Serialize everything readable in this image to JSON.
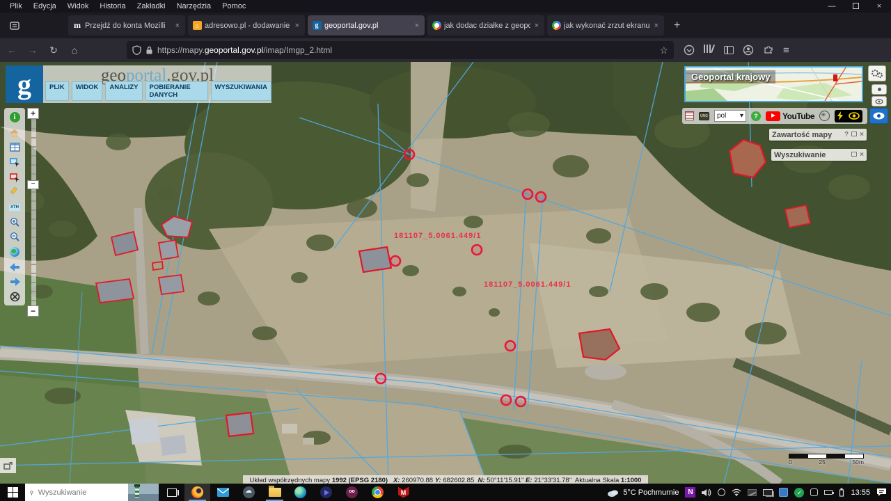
{
  "browser": {
    "menus": [
      "Plik",
      "Edycja",
      "Widok",
      "Historia",
      "Zakładki",
      "Narzędzia",
      "Pomoc"
    ],
    "controls": {
      "minimize": "—",
      "close": "×"
    },
    "tabs": [
      {
        "title": "Przejdź do konta Mozilli"
      },
      {
        "title": "adresowo.pl - dodawanie bezpł"
      },
      {
        "title": "geoportal.gov.pl"
      },
      {
        "title": "jak dodac działke z geoportalu"
      },
      {
        "title": "jak wykonać zrzut ekranu w lapt"
      }
    ],
    "close_glyph": "×",
    "new_tab_glyph": "+",
    "nav": {
      "back": "←",
      "forward": "→",
      "reload": "↻",
      "home": "⌂",
      "bookmark": "☆",
      "menu": "≡"
    },
    "url": {
      "prefix": "https://mapy.",
      "host": "geoportal.gov.pl",
      "path": "/imap/Imgp_2.html"
    }
  },
  "geoportal": {
    "brand": {
      "geo": "geo",
      "portal": "portal",
      "tld": ".gov.pl"
    },
    "menu": [
      "PLIK",
      "WIDOK",
      "ANALIZY",
      "POBIERANIE DANYCH",
      "WYSZUKIWANIA"
    ],
    "logo_glyph": "g",
    "overview_title": "Geoportal krajowy",
    "language_selected": "pol",
    "language_caret": "▾",
    "youtube_label": "YouTube",
    "help_glyph": "?",
    "info_glyph": "i",
    "xth_label": "XTH",
    "panels": {
      "map_contents": "Zawartość mapy",
      "search": "Wyszukiwanie",
      "help_glyph": "?",
      "close_glyph": "×"
    },
    "parcel_label": "181107_5.0061.449/1",
    "scalebar": {
      "zero": "0",
      "mid": "25",
      "max": "50m"
    },
    "statusbar": {
      "crs_label": "Układ współrzędnych mapy",
      "crs_value": "1992 (EPSG 2180)",
      "x_label": "X:",
      "x_value": "260970.88",
      "y_label": "Y:",
      "y_value": "682602.85",
      "n_label": "N:",
      "n_value": "50°11'15.91\"",
      "e_label": "E:",
      "e_value": "21°33'31.78\"",
      "scale_label": "Aktualna Skala",
      "scale_value": "1:1000"
    }
  },
  "taskbar": {
    "search_placeholder": "Wyszukiwanie",
    "weather": "5°C Pochmurnie",
    "time": "13:55",
    "onenote_glyph": "N",
    "oo_glyph": "oo",
    "mcafee_glyph": "M",
    "check_glyph": "✓"
  }
}
